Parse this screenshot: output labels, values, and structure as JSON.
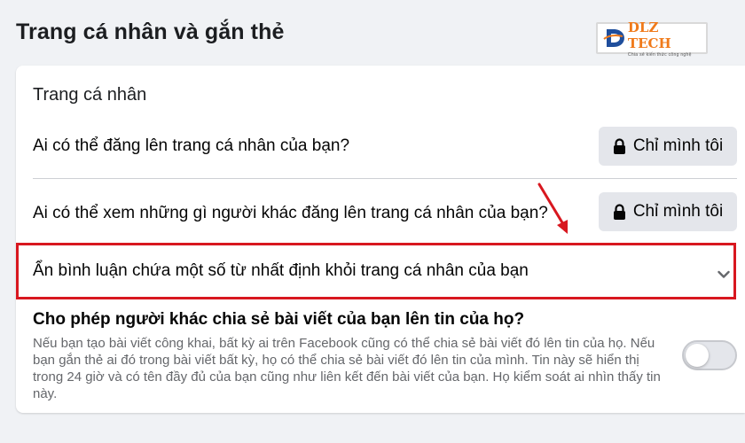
{
  "page_title": "Trang cá nhân và gắn thẻ",
  "logo": {
    "name": "DLZ TECH",
    "tagline": "Chia sẻ kiến thức công nghệ"
  },
  "section_title": "Trang cá nhân",
  "settings": [
    {
      "question": "Ai có thể đăng lên trang cá nhân của bạn?",
      "value": "Chỉ mình tôi"
    },
    {
      "question": "Ai có thể xem những gì người khác đăng lên trang cá nhân của bạn?",
      "value": "Chỉ mình tôi"
    }
  ],
  "hide_comments": {
    "label": "Ẩn bình luận chứa một số từ nhất định khỏi trang cá nhân của bạn"
  },
  "share": {
    "title": "Cho phép người khác chia sẻ bài viết của bạn lên tin của họ?",
    "description": "Nếu bạn tạo bài viết công khai, bất kỳ ai trên Facebook cũng có thể chia sẻ bài viết đó lên tin của họ. Nếu bạn gắn thẻ ai đó trong bài viết bất kỳ, họ có thể chia sẻ bài viết đó lên tin của mình. Tin này sẽ hiển thị trong 24 giờ và có tên đầy đủ của bạn cũng như liên kết đến bài viết của bạn. Họ kiểm soát ai nhìn thấy tin này.",
    "toggle_on": false
  },
  "icons": {
    "lock": "lock-icon",
    "chevron": "chevron-down-icon"
  },
  "colors": {
    "highlight": "#d8171f",
    "button_bg": "#e4e6eb",
    "logo_orange": "#f07a1a",
    "logo_blue": "#1f4e9c"
  }
}
